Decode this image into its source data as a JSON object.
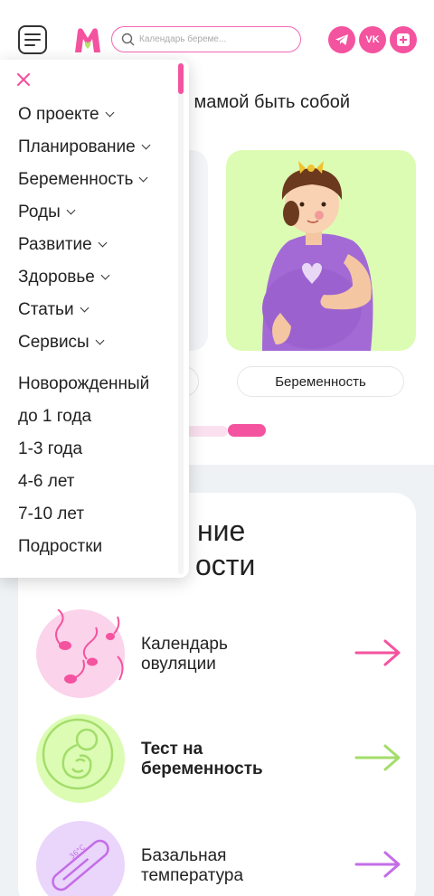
{
  "header": {
    "search_placeholder": "Календарь береме...",
    "social": [
      {
        "name": "telegram",
        "glyph": "➤"
      },
      {
        "name": "vk",
        "glyph": "VK"
      },
      {
        "name": "ok",
        "glyph": "+"
      }
    ]
  },
  "hero": {
    "tagline": "ыть мамой быть собой",
    "card_preg_label": "Беременность"
  },
  "section": {
    "title_line1": "ние",
    "title_line2": "ости"
  },
  "tools": [
    {
      "label_line1": "Календарь",
      "label_line2": "овуляции",
      "color": "#f4539f",
      "circle": "#fbd3ea"
    },
    {
      "label_line1": "Тест на",
      "label_line2": "беременность",
      "color": "#a3dd6a",
      "circle": "#dcfcb4"
    },
    {
      "label_line1": "Базальная",
      "label_line2": "температура",
      "color": "#c46de8",
      "circle": "#ead5fb"
    }
  ],
  "menu": {
    "with_chevron": [
      "О проекте",
      "Планирование",
      "Беременность",
      "Роды",
      "Развитие",
      "Здоровье",
      "Статьи",
      "Сервисы"
    ],
    "plain": [
      "Новорожденный",
      "до 1 года",
      "1-3 года",
      "4-6 лет",
      "7-10 лет",
      "Подростки"
    ]
  },
  "colors": {
    "accent": "#f4539f",
    "green": "#dcfcb4",
    "section_bg": "#eef2f5"
  }
}
